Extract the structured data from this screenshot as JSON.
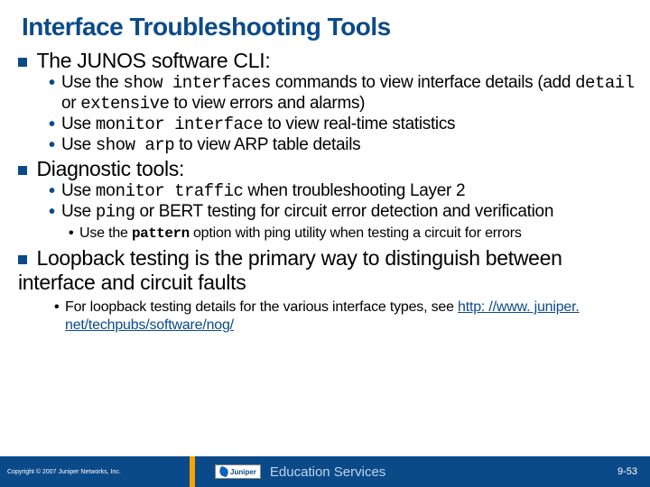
{
  "title": "Interface Troubleshooting Tools",
  "sections": [
    {
      "heading": "The JUNOS software CLI:",
      "sub": [
        [
          "Use the ",
          {
            "mono": "show interfaces"
          },
          " commands to view interface details (add ",
          {
            "mono": "detail"
          },
          " or ",
          {
            "mono": "extensive"
          },
          " to view errors and alarms)"
        ],
        [
          "Use ",
          {
            "mono": "monitor interface"
          },
          " to view real-time statistics"
        ],
        [
          "Use ",
          {
            "mono": "show arp"
          },
          " to view ARP table details"
        ]
      ],
      "subsub": []
    },
    {
      "heading": "Diagnostic tools:",
      "sub": [
        [
          "Use ",
          {
            "mono": "monitor traffic"
          },
          " when troubleshooting Layer 2"
        ],
        [
          "Use ",
          {
            "mono": "ping"
          },
          " or BERT testing for circuit error detection and verification"
        ]
      ],
      "subsub": [
        [
          "Use the ",
          {
            "monob": "pattern"
          },
          " option with ping utility when testing a circuit for errors"
        ]
      ]
    },
    {
      "heading": "Loopback testing is the primary way to distinguish between interface and circuit faults",
      "sub": [],
      "subsub": [
        [
          "For loopback testing details for the various interface types, see ",
          {
            "link": "http: //www. juniper. net/techpubs/software/nog/"
          }
        ]
      ]
    }
  ],
  "footer": {
    "copyright": "Copyright © 2007 Juniper Networks, Inc.",
    "brand": "Juniper",
    "tag": "Education Services",
    "page": "9-53"
  }
}
